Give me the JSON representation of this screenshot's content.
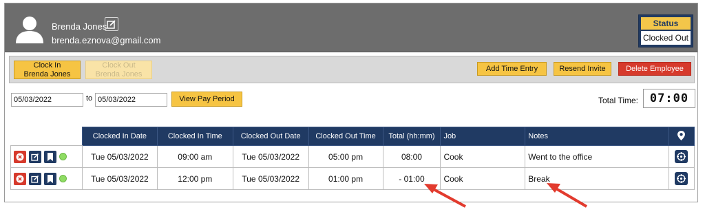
{
  "employee": {
    "name": "Brenda Jones",
    "email": "brenda.eznova@gmail.com"
  },
  "status": {
    "label": "Status",
    "value": "Clocked Out"
  },
  "toolbar": {
    "clock_in_line1": "Clock In",
    "clock_in_line2": "Brenda Jones",
    "clock_out_line1": "Clock Out",
    "clock_out_line2": "Brenda Jones",
    "add_time_entry": "Add Time Entry",
    "resend_invite": "Resend Invite",
    "delete_employee": "Delete Employee"
  },
  "period": {
    "from": "05/03/2022",
    "to_label": "to",
    "to": "05/03/2022",
    "view_pay_period": "View Pay Period",
    "total_time_label": "Total Time:",
    "total_time_value": "07:00"
  },
  "table": {
    "headers": [
      "Clocked In Date",
      "Clocked In Time",
      "Clocked Out Date",
      "Clocked Out Time",
      "Total (hh:mm)",
      "Job",
      "Notes"
    ],
    "rows": [
      {
        "in_date": "Tue 05/03/2022",
        "in_time": "09:00 am",
        "out_date": "Tue 05/03/2022",
        "out_time": "05:00 pm",
        "total": "08:00",
        "job": "Cook",
        "notes": "Went to the office"
      },
      {
        "in_date": "Tue 05/03/2022",
        "in_time": "12:00 pm",
        "out_date": "Tue 05/03/2022",
        "out_time": "01:00 pm",
        "total": "- 01:00",
        "job": "Cook",
        "notes": "Break"
      }
    ]
  },
  "icons": {
    "avatar": "user-avatar-icon",
    "edit": "edit-icon",
    "location": "map-pin-icon",
    "row_delete": "close-icon",
    "row_edit": "edit-icon",
    "row_tag": "tag-icon",
    "row_status": "status-dot",
    "row_location": "target-icon"
  },
  "colors": {
    "header_bg": "#6d6d6d",
    "navy": "#203a63",
    "yellow": "#f6c443",
    "red": "#d63a2c",
    "annotation_arrow": "#e23b2e"
  }
}
